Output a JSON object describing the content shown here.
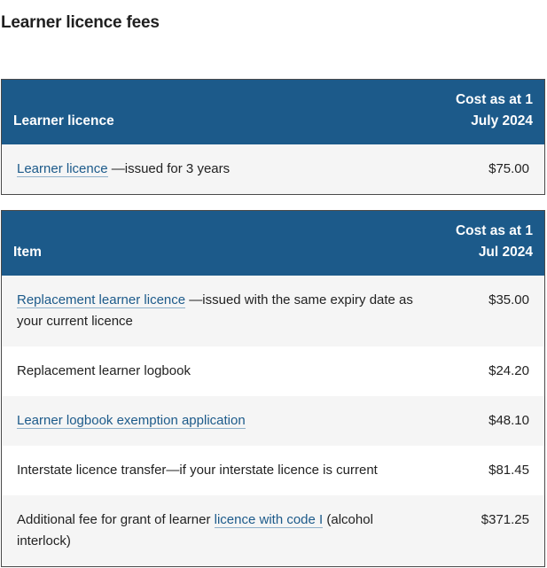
{
  "page_title": "Learner licence fees",
  "table1": {
    "headers": {
      "item": "Learner licence",
      "cost": "Cost as at 1 July 2024"
    },
    "rows": [
      {
        "link": "Learner licence",
        "rest": " —issued for 3 years",
        "cost": "$75.00"
      }
    ]
  },
  "table2": {
    "headers": {
      "item": "Item",
      "cost": "Cost as at 1 Jul 2024"
    },
    "rows": [
      {
        "link": "Replacement learner licence",
        "rest": " —issued with the same expiry date as your current licence",
        "cost": "$35.00"
      },
      {
        "text": "Replacement learner logbook",
        "cost": "$24.20"
      },
      {
        "link": "Learner logbook exemption application",
        "cost": "$48.10"
      },
      {
        "text": "Interstate licence transfer—if your interstate licence is current",
        "cost": "$81.45"
      },
      {
        "before": "Additional fee for grant of learner ",
        "link": "licence with code I",
        "after": " (alcohol interlock)",
        "cost": "$371.25"
      }
    ]
  },
  "colors": {
    "header_bg": "#1c5a8a",
    "link": "#1c5a8a",
    "row_shade": "#f5f5f5"
  }
}
